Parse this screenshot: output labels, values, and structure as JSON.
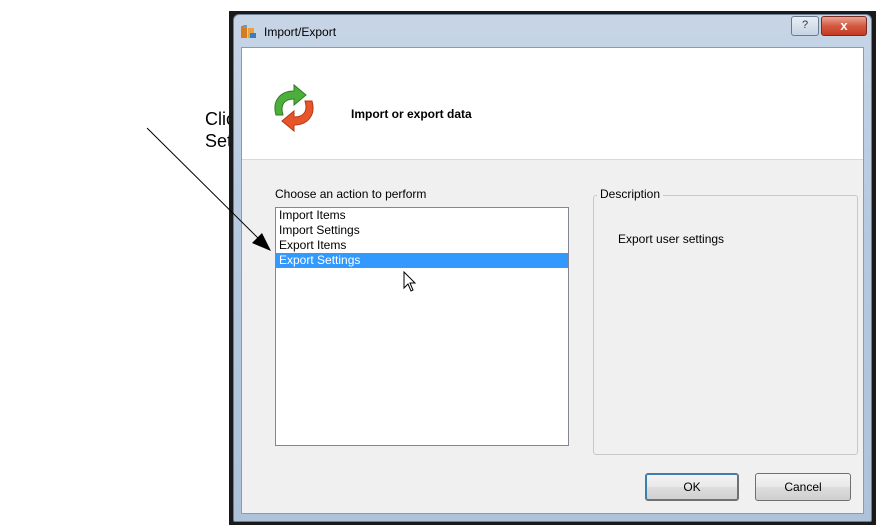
{
  "annotation": {
    "line1": "Click Export",
    "line2": "Settings."
  },
  "window": {
    "title": "Import/Export",
    "help_button": "?",
    "close_button": "x"
  },
  "header": {
    "title": "Import or export data",
    "icon": "refresh-arrows-icon"
  },
  "actions": {
    "label": "Choose an action to perform",
    "items": [
      "Import Items",
      "Import Settings",
      "Export Items",
      "Export Settings"
    ],
    "selected_index": 3
  },
  "description": {
    "legend": "Description",
    "text": "Export user settings"
  },
  "buttons": {
    "ok": "OK",
    "cancel": "Cancel"
  },
  "colors": {
    "selection": "#3399ff",
    "close_button": "#c43b21"
  }
}
